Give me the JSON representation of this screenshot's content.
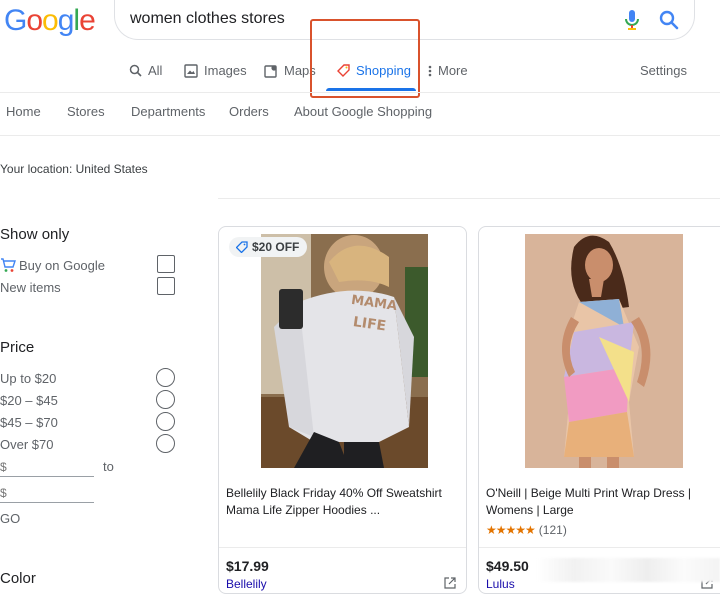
{
  "logo": {
    "letters": [
      "G",
      "o",
      "o",
      "g",
      "l",
      "e"
    ],
    "colors": [
      "#4285F4",
      "#EA4335",
      "#FBBC05",
      "#4285F4",
      "#34A853",
      "#EA4335"
    ]
  },
  "search": {
    "query": "women clothes stores"
  },
  "tabs": [
    {
      "label": "All",
      "icon": "search-icon"
    },
    {
      "label": "Images",
      "icon": "image-icon"
    },
    {
      "label": "Maps",
      "icon": "map-icon"
    },
    {
      "label": "Shopping",
      "icon": "tag-icon",
      "active": true
    },
    {
      "label": "More",
      "icon": "more-vert-icon"
    }
  ],
  "settings_label": "Settings",
  "shop_nav": [
    "Home",
    "Stores",
    "Departments",
    "Orders",
    "About Google Shopping"
  ],
  "location": "Your location: United States",
  "filters": {
    "show_only": {
      "heading": "Show only",
      "options": [
        "Buy on Google",
        "New items"
      ]
    },
    "price": {
      "heading": "Price",
      "options": [
        "Up to $20",
        "$20 – $45",
        "$45 – $70",
        "Over $70"
      ],
      "min_placeholder": "$",
      "max_placeholder": "$",
      "to_label": "to",
      "go_label": "GO"
    },
    "color": {
      "heading": "Color"
    }
  },
  "products": [
    {
      "badge": "$20 OFF",
      "title": "Bellelily Black Friday 40% Off Sweatshirt Mama Life Zipper Hoodies ...",
      "price": "$17.99",
      "merchant": "Bellelily"
    },
    {
      "title": "O'Neill | Beige Multi Print Wrap Dress | Womens | Large",
      "rating_count": "(121)",
      "rating_value": 4.5,
      "price": "$49.50",
      "merchant": "Lulus"
    }
  ]
}
